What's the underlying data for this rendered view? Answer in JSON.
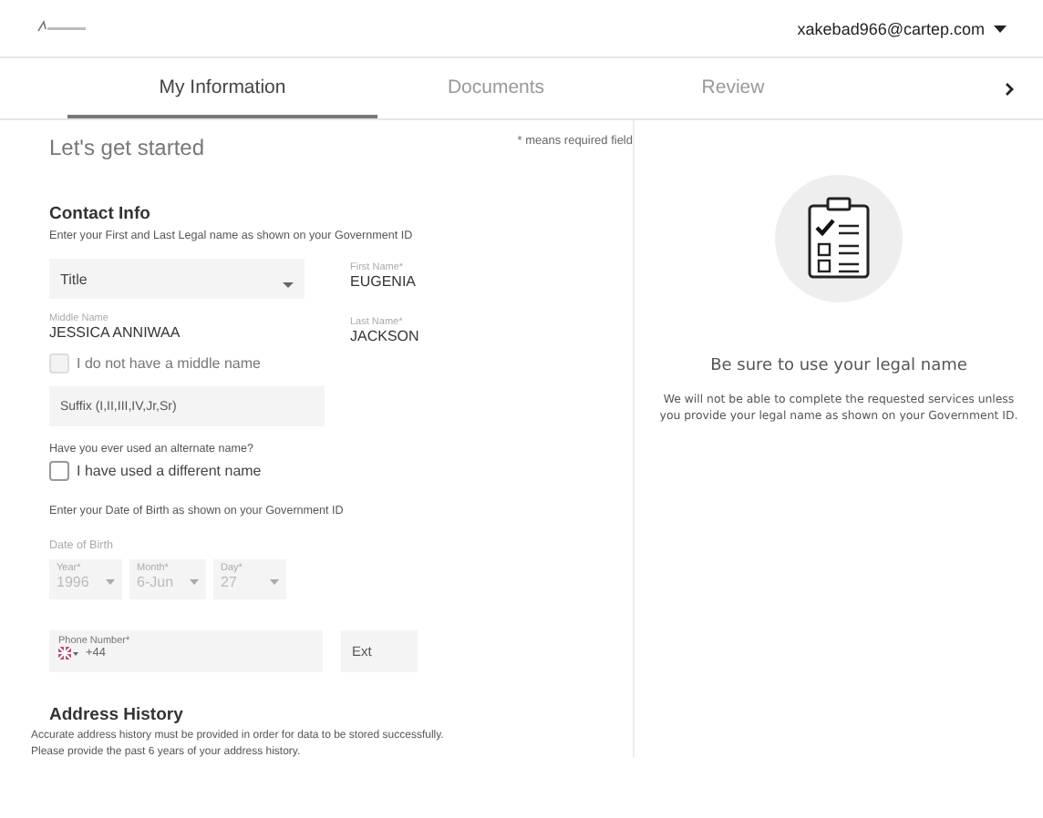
{
  "header": {
    "account_email": "xakebad966@cartep.com"
  },
  "tabs": [
    {
      "label": "My Information",
      "selected": true
    },
    {
      "label": "Documents",
      "selected": false
    },
    {
      "label": "Review",
      "selected": false
    }
  ],
  "form": {
    "heading": "Let's get started",
    "required_note": "* means required field",
    "contact_info": {
      "heading": "Contact Info",
      "instruction": "Enter your First and Last Legal name as shown on your Government ID",
      "title_select": {
        "placeholder": "Title"
      },
      "first_name": {
        "label": "First Name*",
        "value": "EUGENIA"
      },
      "middle_name": {
        "label": "Middle Name",
        "value": "JESSICA ANNIWAA"
      },
      "last_name": {
        "label": "Last Name*",
        "value": "JACKSON"
      },
      "no_middle_name": {
        "label": "I do not have a middle name",
        "checked": false,
        "disabled": true
      },
      "suffix": {
        "placeholder": "Suffix (I,II,III,IV,Jr,Sr)"
      },
      "alternate_question": "Have you ever used an alternate name?",
      "different_name": {
        "label": "I have used a different name",
        "checked": false,
        "disabled": false
      },
      "dob_instruction": "Enter your Date of Birth as shown on your Government ID",
      "dob_label": "Date of Birth",
      "dob": [
        {
          "label": "Year*",
          "value": "1996",
          "disabled": true
        },
        {
          "label": "Month*",
          "value": "6-Jun",
          "disabled": true
        },
        {
          "label": "Day*",
          "value": "27",
          "disabled": true
        }
      ],
      "phone": {
        "label": "Phone Number*",
        "value": "+44"
      },
      "ext": {
        "placeholder": "Ext"
      }
    },
    "address_history": {
      "heading": "Address History",
      "lines": [
        "Accurate address history must be provided in order for data to be stored successfully.",
        "Please provide the past 6 years of your address history."
      ]
    }
  },
  "side_panel": {
    "heading": "Be sure to use your legal name",
    "text": "We will not be able to complete the requested services unless you provide your legal name as shown on your Government ID."
  }
}
